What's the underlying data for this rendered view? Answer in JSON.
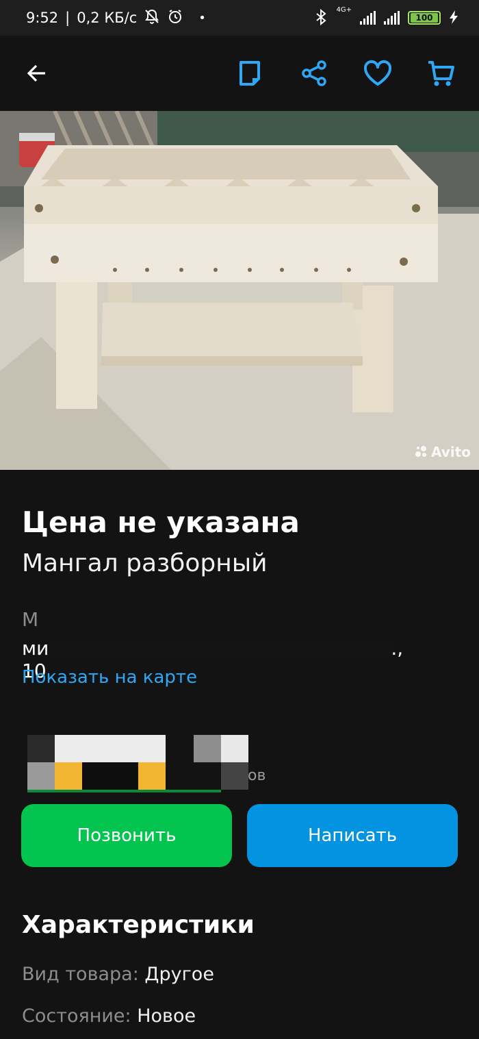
{
  "status_bar": {
    "time": "9:52",
    "network_speed": "0,2 КБ/с",
    "network_type": "4G+",
    "battery": "100",
    "icons": [
      "mute-bell-icon",
      "alarm-icon",
      "bluetooth-icon",
      "signal-icon",
      "battery-icon",
      "charging-icon"
    ]
  },
  "toolbar": {
    "icons": [
      "back-arrow-icon",
      "note-icon",
      "share-icon",
      "favorite-heart-icon",
      "cart-icon"
    ],
    "accent_color": "#2ea8f5"
  },
  "photo": {
    "watermark": "Avito"
  },
  "listing": {
    "price": "Цена не указана",
    "title": "Мангал разборный",
    "address_line1": "М",
    "address_line2_start": "ми",
    "address_line2_end": "., 10",
    "map_link": "Показать на карте"
  },
  "seller": {
    "tail_text": "ов"
  },
  "actions": {
    "call_label": "Позвонить",
    "call_color": "#04c450",
    "write_label": "Написать",
    "write_color": "#0393e0"
  },
  "specs": {
    "heading": "Характеристики",
    "rows": [
      {
        "key": "Вид товара:",
        "value": "Другое"
      },
      {
        "key": "Состояние:",
        "value": "Новое"
      }
    ]
  }
}
